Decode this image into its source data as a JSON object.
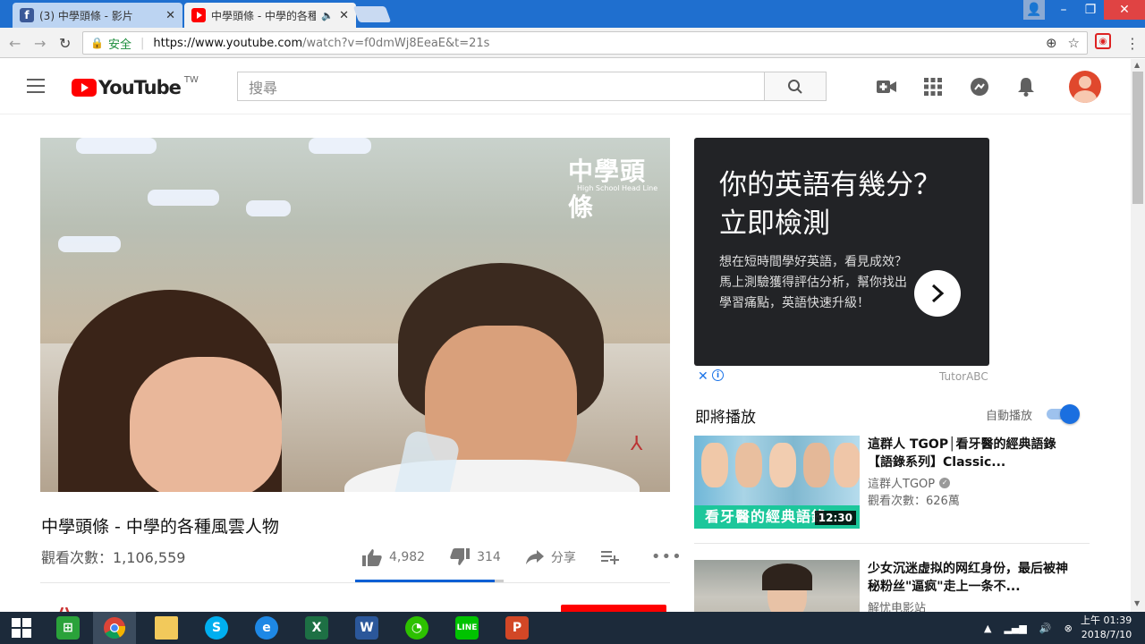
{
  "browser": {
    "tabs": [
      {
        "label": "(3) 中學頭條 - 影片",
        "favicon": "facebook-icon",
        "color": "#3b5998"
      },
      {
        "label": "中學頭條 - 中學的各種",
        "favicon": "youtube-icon",
        "color": "#ff0000",
        "audio": "🔈"
      }
    ],
    "security_label": "安全",
    "url_host": "https://www.youtube.com",
    "url_rest": "/watch?v=f0dmWj8EeaE&t=21s"
  },
  "header": {
    "logo": "YouTube",
    "region": "TW",
    "search_placeholder": "搜尋"
  },
  "video": {
    "watermark": "中學頭條",
    "watermark_sub": "High School Head Line",
    "title": "中學頭條 - 中學的各種風雲人物",
    "views": "觀看次數：1,106,559",
    "likes": "4,982",
    "dislikes": "314",
    "share_label": "分享",
    "like_ratio": 0.94
  },
  "ad": {
    "headline_1": "你的英語有幾分？",
    "headline_2": "立即檢測",
    "body": "想在短時間學好英語，看見成效？馬上測驗獲得評估分析，幫你找出學習痛點，英語快速升級！",
    "brand": "TutorABC"
  },
  "up_next": {
    "title": "即將播放",
    "autoplay_label": "自動播放",
    "autoplay_on": true
  },
  "recommendations": [
    {
      "title": "這群人 TGOP│看牙醫的經典語錄【語錄系列】Classic...",
      "channel": "這群人TGOP",
      "verified": true,
      "views": "觀看次數：626萬",
      "duration": "12:30",
      "thumb_caption": "看牙醫的經典語錄"
    },
    {
      "title": "少女沉迷虚拟的网红身份，最后被神秘粉丝\"逼疯\"走上一条不...",
      "channel": "解忧电影站",
      "verified": false,
      "views": "",
      "duration": "",
      "thumb_caption": ""
    }
  ],
  "taskbar": {
    "time": "上午 01:39",
    "date": "2018/7/10"
  },
  "colors": {
    "accent": "#065fd4",
    "brand_red": "#ff0000",
    "taskbar": "#1c2a3a"
  }
}
